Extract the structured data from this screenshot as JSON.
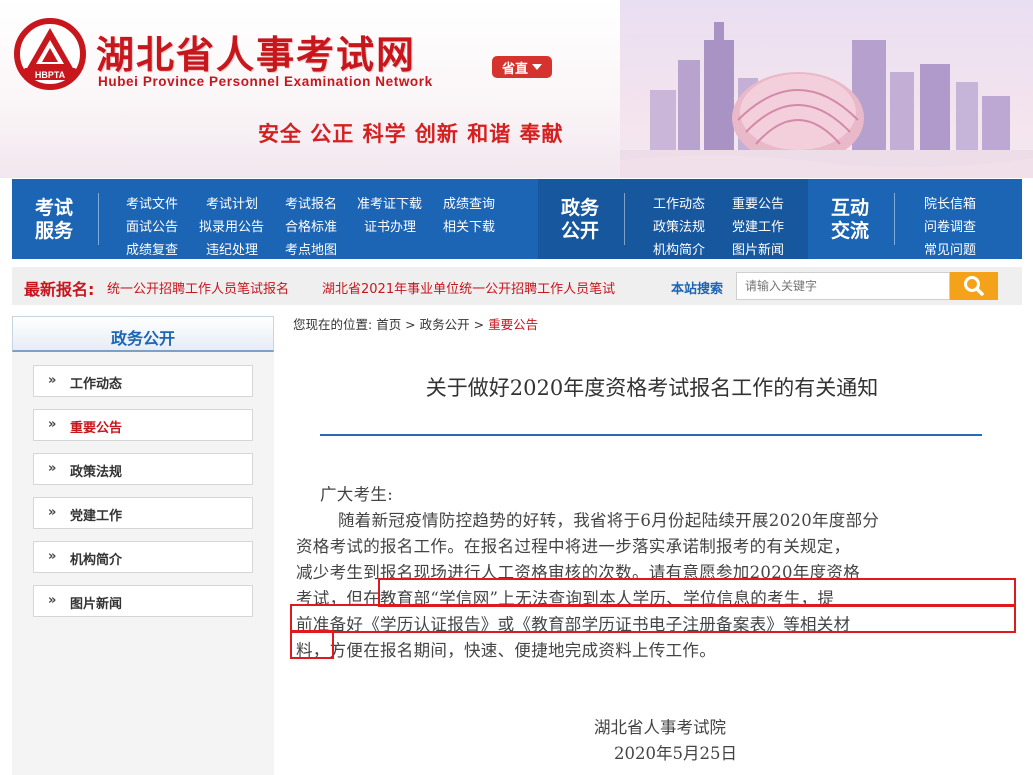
{
  "header": {
    "site_title": "湖北省人事考试网",
    "site_subtitle": "Hubei Province Personnel Examination Network",
    "emblem_text": "HBPTA",
    "region_selector": "省直",
    "slogan": "安全  公正  科学  创新  和谐  奉献",
    "colors": {
      "brand_red": "#c8161d",
      "nav_blue": "#1c64b4"
    }
  },
  "nav": {
    "exam_service": {
      "title": "考试服务",
      "links": [
        "考试文件",
        "考试计划",
        "考试报名",
        "准考证下载",
        "成绩查询",
        "面试公告",
        "拟录用公告",
        "合格标准",
        "证书办理",
        "相关下载",
        "成绩复查",
        "违纪处理",
        "考点地图"
      ]
    },
    "gov_affairs": {
      "title": "政务公开",
      "links": [
        "工作动态",
        "重要公告",
        "政策法规",
        "党建工作",
        "机构简介",
        "图片新闻"
      ]
    },
    "interaction": {
      "title": "互动交流",
      "links": [
        "院长信箱",
        "问卷调查",
        "常见问题"
      ]
    }
  },
  "ticker": {
    "label": "最新报名:",
    "items": [
      "统一公开招聘工作人员笔试报名",
      "湖北省2021年事业单位统一公开招聘工作人员笔试"
    ]
  },
  "search": {
    "label": "本站搜索",
    "placeholder": "请输入关键字",
    "button_icon": "search-icon"
  },
  "sidebar": {
    "title": "政务公开",
    "items": [
      {
        "label": "工作动态",
        "active": false
      },
      {
        "label": "重要公告",
        "active": true
      },
      {
        "label": "政策法规",
        "active": false
      },
      {
        "label": "党建工作",
        "active": false
      },
      {
        "label": "机构简介",
        "active": false
      },
      {
        "label": "图片新闻",
        "active": false
      }
    ]
  },
  "breadcrumb": {
    "prefix": "您现在的位置: ",
    "home": "首页",
    "sep": " > ",
    "section": "政务公开",
    "current": "重要公告"
  },
  "article": {
    "title": "关于做好2020年度资格考试报名工作的有关通知",
    "greeting": "广大考生:",
    "lines": [
      "随着新冠疫情防控趋势的好转，我省将于6月份起陆续开展2020年度部分",
      "资格考试的报名工作。在报名过程中将进一步落实承诺制报考的有关规定，",
      "减少考生到报名现场进行人工资格审核的次数。请有意愿参加2020年度资格",
      "考试，但在教育部“学信网”上无法查询到本人学历、学位信息的考生，提",
      "前准备好《学历认证报告》或《教育部学历证书电子注册备案表》等相关材",
      "料，方便在报名期间，快速、便捷地完成资料上传工作。"
    ],
    "signature": "湖北省人事考试院",
    "date": "2020年5月25日",
    "highlight_color": "#e0191e"
  }
}
